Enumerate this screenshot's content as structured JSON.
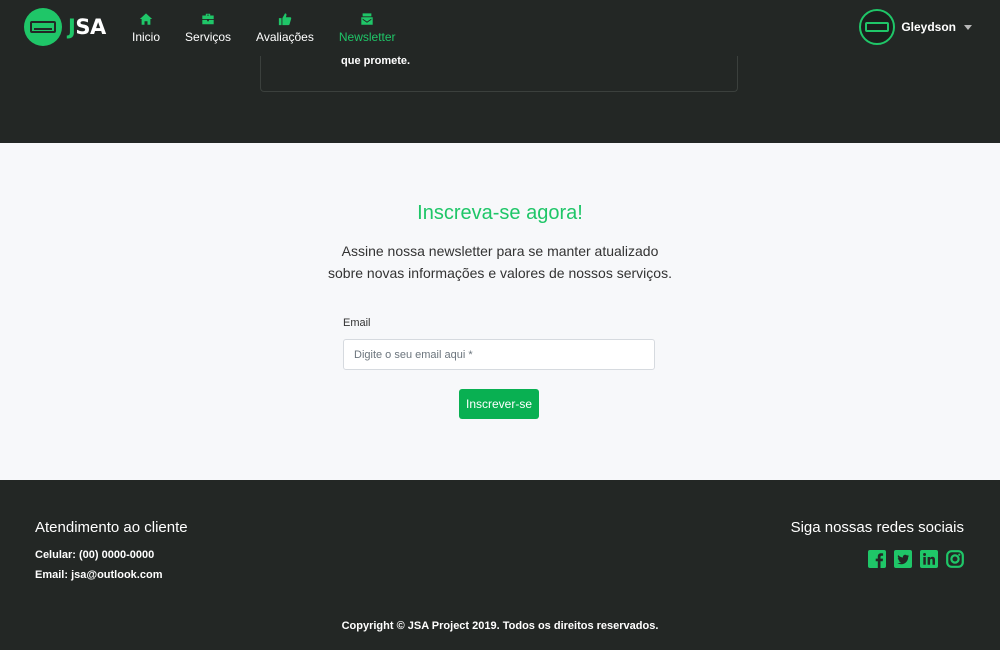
{
  "brand": {
    "letter_j": "J",
    "letters_sa": "SA",
    "icon": "air-conditioner-icon"
  },
  "nav": [
    {
      "label": "Inicio",
      "icon": "home-icon",
      "active": false
    },
    {
      "label": "Serviços",
      "icon": "toolbox-icon",
      "active": false
    },
    {
      "label": "Avaliações",
      "icon": "thumbs-up-icon",
      "active": false
    },
    {
      "label": "Newsletter",
      "icon": "mail-bulk-icon",
      "active": true
    }
  ],
  "user": {
    "name": "Gleydson",
    "avatar_icon": "air-conditioner-icon"
  },
  "testimonial": {
    "text_fragment": "que promete."
  },
  "newsletter": {
    "title": "Inscreva-se agora!",
    "description_line1": "Assine nossa newsletter para se manter atualizado",
    "description_line2": "sobre novas informações e valores de nossos serviços.",
    "email_label": "Email",
    "email_placeholder": "Digite o seu email aqui *",
    "submit_label": "Inscrever-se"
  },
  "footer": {
    "support_title": "Atendimento ao cliente",
    "phone": "Celular: (00) 0000-0000",
    "email": "Email: jsa@outlook.com",
    "social_title": "Siga nossas redes sociais",
    "socials": [
      "facebook-icon",
      "twitter-icon",
      "linkedin-icon",
      "instagram-icon"
    ],
    "copyright": "Copyright © JSA Project 2019. Todos os direitos reservados."
  },
  "colors": {
    "accent": "#1fc668",
    "button": "#09b052",
    "dark": "#232725",
    "light_bg": "#f7f8fa"
  }
}
